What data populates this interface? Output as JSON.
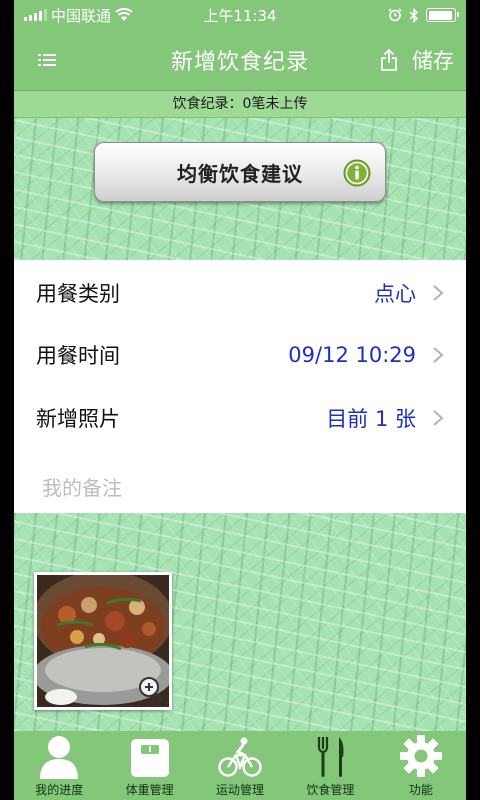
{
  "status_bar": {
    "carrier": "中国联通",
    "time": "上午11:34",
    "battery_level": 0.92
  },
  "nav": {
    "title": "新增饮食纪录",
    "save_label": "储存"
  },
  "sync": {
    "text": "饮食纪录：0笔未上传"
  },
  "advice_button": {
    "label": "均衡饮食建议"
  },
  "form": {
    "rows": [
      {
        "label": "用餐类别",
        "value": "点心"
      },
      {
        "label": "用餐时间",
        "value": "09/12 10:29"
      },
      {
        "label": "新增照片",
        "value": "目前 1 张"
      }
    ],
    "notes_placeholder": "我的备注"
  },
  "tabs": [
    {
      "label": "我的进度",
      "icon": "person-icon"
    },
    {
      "label": "体重管理",
      "icon": "scale-icon"
    },
    {
      "label": "运动管理",
      "icon": "bicycle-icon"
    },
    {
      "label": "饮食管理",
      "icon": "fork-knife-icon"
    },
    {
      "label": "功能",
      "icon": "gear-icon"
    }
  ],
  "colors": {
    "header_green": "#84c67a",
    "texture_green": "#a6e2b2",
    "value_blue": "#1e2fc4"
  }
}
